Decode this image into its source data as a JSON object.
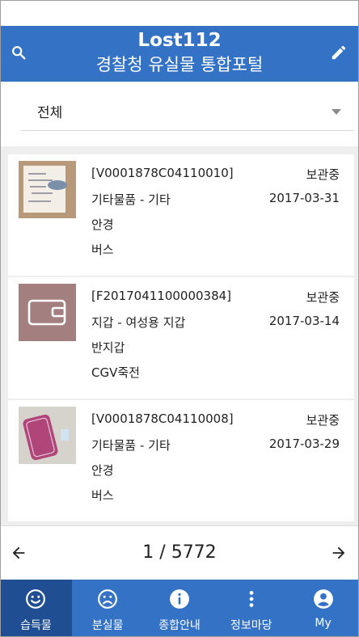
{
  "header": {
    "title_line1": "Lost112",
    "title_line2": "경찰청 유실물 통합포털"
  },
  "filter": {
    "selected": "전체"
  },
  "items": [
    {
      "code": "[V0001878C04110010]",
      "status": "보관중",
      "category": "기타물품 - 기타",
      "date": "2017-03-31",
      "name": "안경",
      "place": "버스"
    },
    {
      "code": "[F2017041100000384]",
      "status": "보관중",
      "category": "지갑 - 여성용 지갑",
      "date": "2017-03-14",
      "name": "반지갑",
      "place": "CGV죽전"
    },
    {
      "code": "[V0001878C04110008]",
      "status": "보관중",
      "category": "기타물품 - 기타",
      "date": "2017-03-29",
      "name": "안경",
      "place": "버스"
    }
  ],
  "pager": {
    "text": "1 / 5772"
  },
  "nav": {
    "tabs": [
      {
        "label": "습득물",
        "icon": "smile-icon"
      },
      {
        "label": "분실물",
        "icon": "sad-icon"
      },
      {
        "label": "종합안내",
        "icon": "info-icon"
      },
      {
        "label": "정보마당",
        "icon": "more-vert-icon"
      },
      {
        "label": "My",
        "icon": "account-icon"
      }
    ]
  },
  "colors": {
    "primary": "#3472c6",
    "active_tab": "#1f4f92",
    "wallet_thumb": "#a47f80"
  }
}
